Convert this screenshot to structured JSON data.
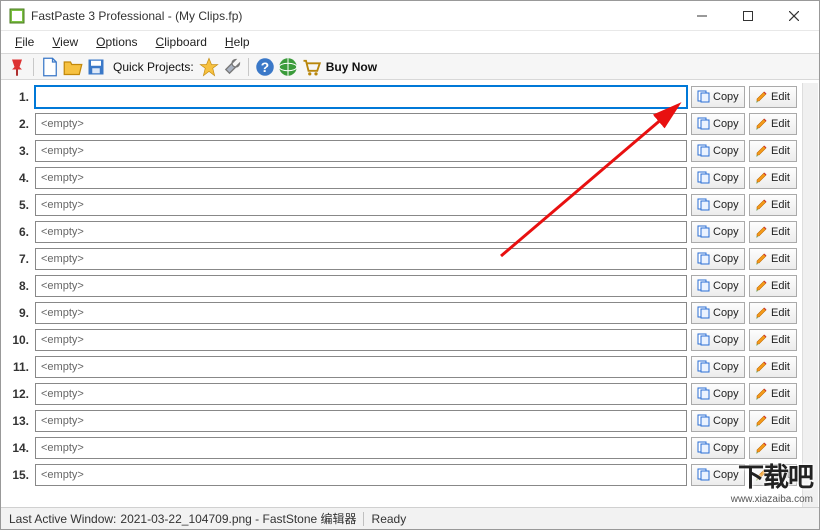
{
  "window": {
    "title": "FastPaste 3 Professional -  (My Clips.fp)"
  },
  "menu": {
    "file": "File",
    "view": "View",
    "options": "Options",
    "clipboard": "Clipboard",
    "help": "Help"
  },
  "toolbar": {
    "quick_projects": "Quick Projects:",
    "buy_now": "Buy Now"
  },
  "clips": [
    {
      "num": "1.",
      "value": "",
      "active": true
    },
    {
      "num": "2.",
      "value": "<empty>"
    },
    {
      "num": "3.",
      "value": "<empty>"
    },
    {
      "num": "4.",
      "value": "<empty>"
    },
    {
      "num": "5.",
      "value": "<empty>"
    },
    {
      "num": "6.",
      "value": "<empty>"
    },
    {
      "num": "7.",
      "value": "<empty>"
    },
    {
      "num": "8.",
      "value": "<empty>"
    },
    {
      "num": "9.",
      "value": "<empty>"
    },
    {
      "num": "10.",
      "value": "<empty>"
    },
    {
      "num": "11.",
      "value": "<empty>"
    },
    {
      "num": "12.",
      "value": "<empty>"
    },
    {
      "num": "13.",
      "value": "<empty>"
    },
    {
      "num": "14.",
      "value": "<empty>"
    },
    {
      "num": "15.",
      "value": "<empty>"
    }
  ],
  "buttons": {
    "copy": "Copy",
    "edit": "Edit"
  },
  "status": {
    "label": "Last Active Window:",
    "window_name": "2021-03-22_104709.png - FastStone 编辑器",
    "ready": "Ready"
  },
  "watermark": {
    "main": "下载吧",
    "url": "www.xiazaiba.com"
  },
  "icon_names": {
    "pin": "pin-icon",
    "new": "new-file-icon",
    "open": "open-folder-icon",
    "save": "save-icon",
    "star": "star-icon",
    "wrench": "wrench-icon",
    "help": "help-icon",
    "globe": "globe-icon",
    "cart": "cart-icon",
    "copy": "copy-pages-icon",
    "edit": "pencil-icon"
  }
}
